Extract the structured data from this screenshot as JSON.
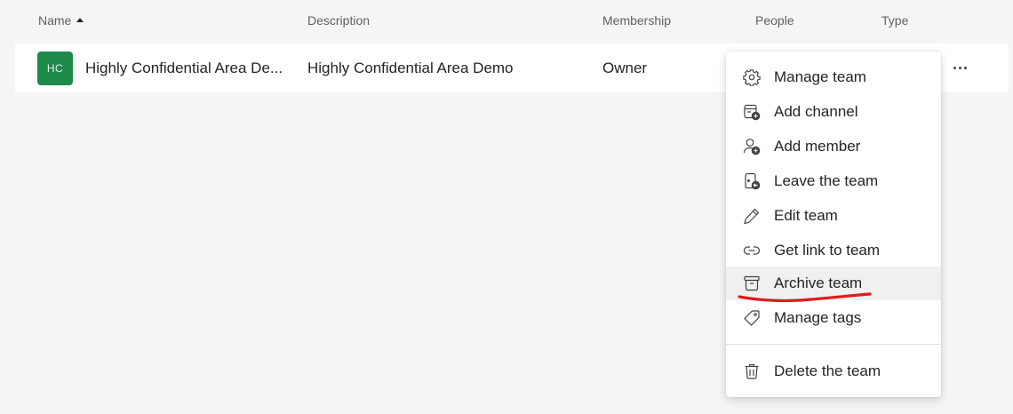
{
  "headers": {
    "name": "Name",
    "description": "Description",
    "membership": "Membership",
    "people": "People",
    "type": "Type"
  },
  "team": {
    "initials": "HC",
    "name": "Highly Confidential Area De...",
    "description": "Highly Confidential Area Demo",
    "membership": "Owner",
    "avatar_color": "#1e8a4a"
  },
  "menu": {
    "items": [
      {
        "label": "Manage team",
        "icon": "gear-icon"
      },
      {
        "label": "Add channel",
        "icon": "add-channel-icon"
      },
      {
        "label": "Add member",
        "icon": "add-member-icon"
      },
      {
        "label": "Leave the team",
        "icon": "leave-team-icon"
      },
      {
        "label": "Edit team",
        "icon": "pencil-icon"
      },
      {
        "label": "Get link to team",
        "icon": "link-icon"
      },
      {
        "label": "Archive team",
        "icon": "archive-icon"
      },
      {
        "label": "Manage tags",
        "icon": "tag-icon"
      },
      {
        "label": "Delete the team",
        "icon": "trash-icon"
      }
    ],
    "highlighted": "Archive team"
  },
  "annotation_color": "#e01b1b"
}
